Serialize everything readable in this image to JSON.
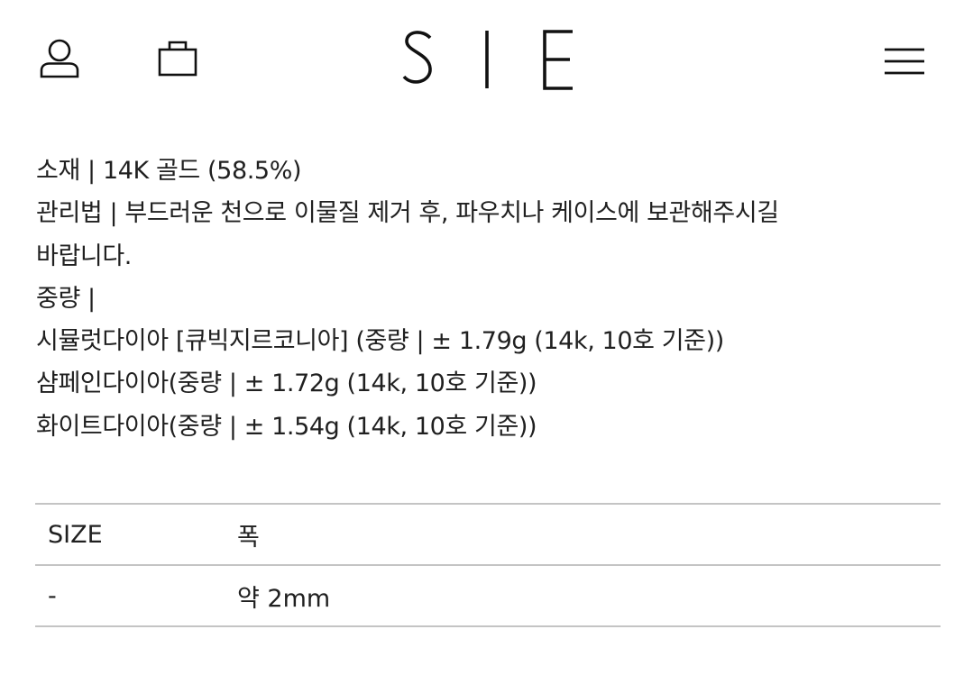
{
  "header": {
    "logo_text": "SIE",
    "icons": {
      "account": "user-icon",
      "cart": "shopping-bag-icon",
      "menu": "hamburger-menu-icon"
    }
  },
  "product_info": {
    "lines": [
      "소재 | 14K 골드 (58.5%)",
      "관리법 | 부드러운 천으로 이물질 제거 후, 파우치나 케이스에 보관해주시길",
      "바랍니다.",
      "중량 |",
      "시뮬럿다이아 [큐빅지르코니아] (중량 | ± 1.79g (14k, 10호 기준))",
      "샴페인다이아(중량 |  ± 1.72g (14k, 10호 기준))",
      "화이트다이아(중량 |  ± 1.54g (14k, 10호 기준))"
    ]
  },
  "size_table": {
    "headers": [
      "SIZE",
      "폭"
    ],
    "rows": [
      [
        "-",
        "약 2mm"
      ]
    ]
  },
  "colors": {
    "text": "#202020",
    "divider": "#c4c4c4",
    "background": "#ffffff"
  }
}
